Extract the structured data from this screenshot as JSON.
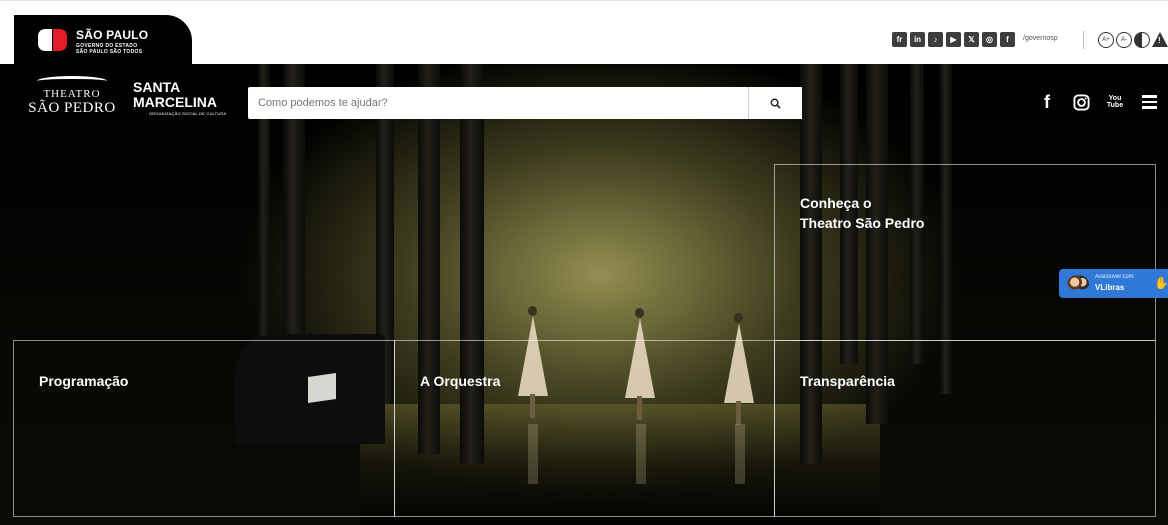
{
  "gov_bar": {
    "logo_title": "SÃO PAULO",
    "logo_subtitle_1": "GOVERNO DO ESTADO",
    "logo_subtitle_2": "SÃO PAULO SÃO TODOS",
    "social_icons": [
      "fr",
      "in",
      "tiktok",
      "youtube",
      "x",
      "instagram",
      "facebook"
    ],
    "social_glyphs": [
      "fr",
      "in",
      "♪",
      "▶",
      "𝕏",
      "◎",
      "f"
    ],
    "handle": "/governosp",
    "accessibility_icons": [
      "increase-font-icon",
      "decrease-font-icon",
      "contrast-icon",
      "alert-icon"
    ],
    "accessibility_glyphs": [
      "A+",
      "A-",
      "",
      ""
    ]
  },
  "header": {
    "site_logo_line1": "THEATRO",
    "site_logo_line2": "SÃO PEDRO",
    "partner_logo_line1": "SANTA",
    "partner_logo_line2": "MARCELINA",
    "partner_logo_tagline": "ORGANIZAÇÃO SOCIAL DE CULTURA",
    "search_placeholder": "Como podemos te ajudar?",
    "nav_icons": [
      "facebook-icon",
      "instagram-icon",
      "youtube-icon",
      "menu-icon"
    ],
    "fb_glyph": "f",
    "ig_glyph": "◎",
    "yt_line1": "You",
    "yt_line2": "Tube"
  },
  "panels": {
    "conheca": "Conheça o\nTheatro São Pedro",
    "programacao": "Programação",
    "orquestra": "A Orquestra",
    "transparencia": "Transparência"
  },
  "vlibras": {
    "line1": "Acessível com",
    "line2": "VLibras",
    "hand_glyph": "✋"
  },
  "colors": {
    "gov_red": "#e11d2a",
    "vlibras_blue": "#2f78d6"
  }
}
